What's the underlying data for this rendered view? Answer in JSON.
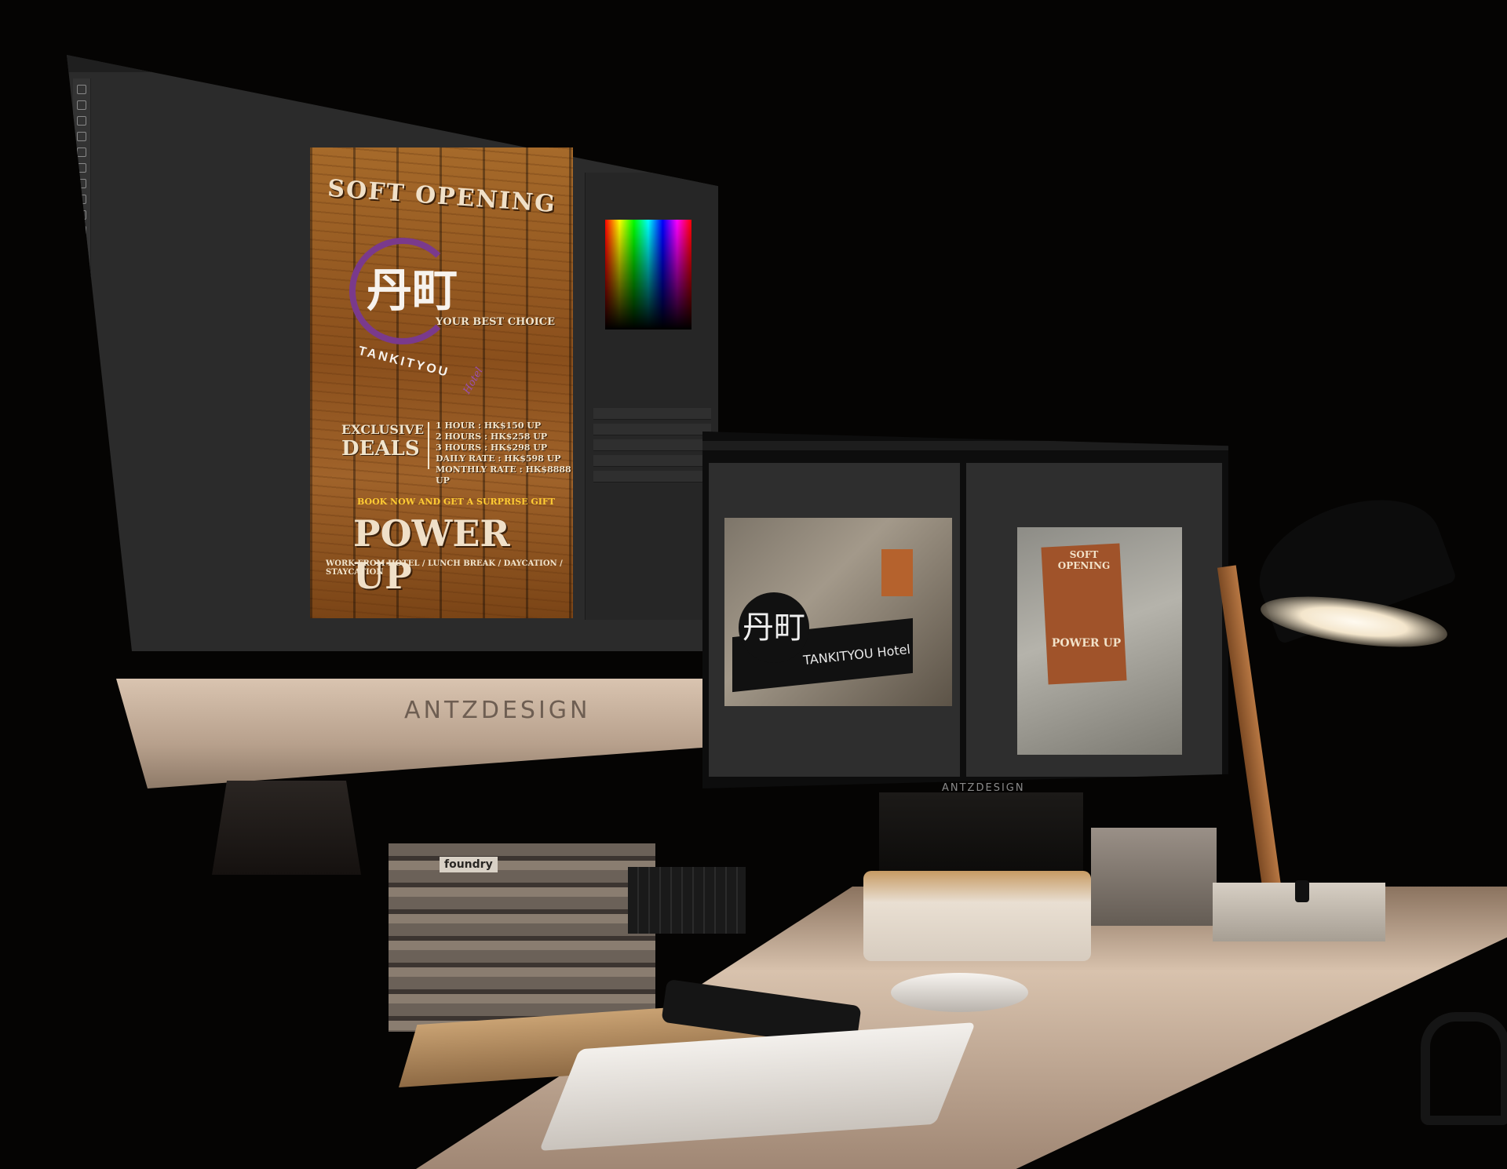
{
  "left_monitor": {
    "app": "photo-editor",
    "brand": "ANTZDESIGN",
    "poster": {
      "title": "SOFT OPENING",
      "logo_kanji": "丹町",
      "logo_brand": "TANKITYOU",
      "logo_hotel": "Hotel",
      "best_choice": "YOUR BEST CHOICE",
      "exclusive": "EXCLUSIVE",
      "deals": "DEALS",
      "rates": [
        "1 HOUR   : HK$150 UP",
        "2 HOURS : HK$258 UP",
        "3 HOURS : HK$298 UP",
        "DAILY RATE : HK$598 UP",
        "MONTHLY RATE : HK$8888 UP"
      ],
      "book_now": "BOOK NOW AND GET A SURPRISE GIFT",
      "power_up": "POWER UP",
      "tagline": "WORK FROM HOTEL / LUNCH BREAK / DAYCATION / STAYCATION"
    }
  },
  "right_monitor": {
    "brand": "ANTZDESIGN",
    "left_photo": {
      "sign_kanji": "丹町",
      "sign_text": "TANKITYOU Hotel"
    },
    "right_photo": {
      "poster_title": "SOFT OPENING",
      "poster_power": "POWER UP"
    }
  },
  "desk": {
    "book_label": "foundry"
  },
  "colors": {
    "background": "#050403",
    "ps_dark": "#2b2b2b",
    "poster_wood": "#8a4f1c",
    "logo_purple": "#7a3a8c",
    "lamp_light": "#fffaf0"
  },
  "icons": [
    "lamp-icon",
    "mouse-icon",
    "keyboard-icon"
  ]
}
